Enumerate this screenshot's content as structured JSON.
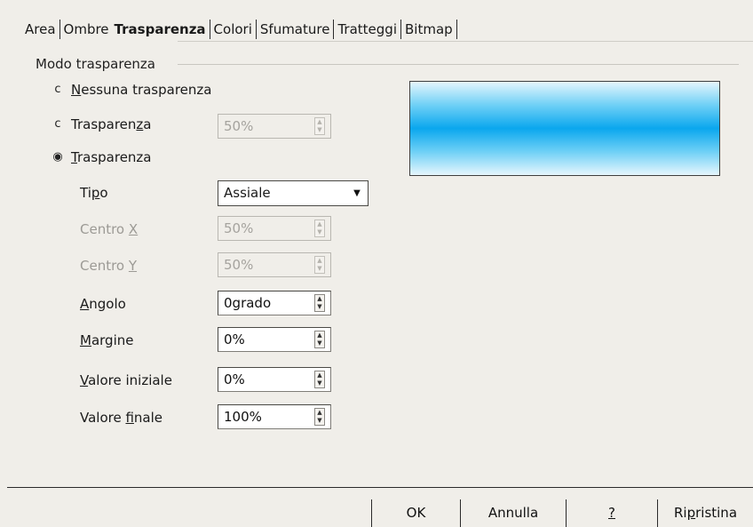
{
  "tabs": [
    {
      "label": "Area"
    },
    {
      "label": "Ombre"
    },
    {
      "label": "Trasparenza"
    },
    {
      "label": "Colori"
    },
    {
      "label": "Sfumature"
    },
    {
      "label": "Tratteggi"
    },
    {
      "label": "Bitmap"
    }
  ],
  "section": {
    "title": "Modo trasparenza"
  },
  "mode": {
    "none": {
      "accel": "N",
      "rest": "essuna trasparenza",
      "selected": false
    },
    "linear": {
      "pre": "Trasparen",
      "accel": "z",
      "post": "a",
      "selected": false,
      "value": "50%"
    },
    "gradient": {
      "accel": "T",
      "rest": "rasparenza",
      "selected": true
    }
  },
  "fields": {
    "tipo": {
      "pre": "Ti",
      "accel": "p",
      "post": "o",
      "value": "Assiale"
    },
    "centro_x": {
      "pre": "Centro ",
      "accel": "X",
      "value": "50%"
    },
    "centro_y": {
      "pre": "Centro ",
      "accel": "Y",
      "value": "50%"
    },
    "angolo": {
      "accel": "A",
      "rest": "ngolo",
      "value": "0grado"
    },
    "margine": {
      "accel": "M",
      "rest": "argine",
      "value": "0%"
    },
    "valore_iniziale": {
      "accel": "V",
      "rest": "alore iniziale",
      "value": "0%"
    },
    "valore_finale": {
      "pre": "Valore ",
      "accel": "f",
      "post": "inale",
      "value": "100%"
    }
  },
  "preview": {
    "gradient_colors": [
      "#e6f6fd",
      "#0aa7ee"
    ]
  },
  "buttons": {
    "ok": "OK",
    "annulla": "Annulla",
    "help": "?",
    "ripristina_pre": "Ri",
    "ripristina_accel": "p",
    "ripristina_post": "ristina"
  }
}
